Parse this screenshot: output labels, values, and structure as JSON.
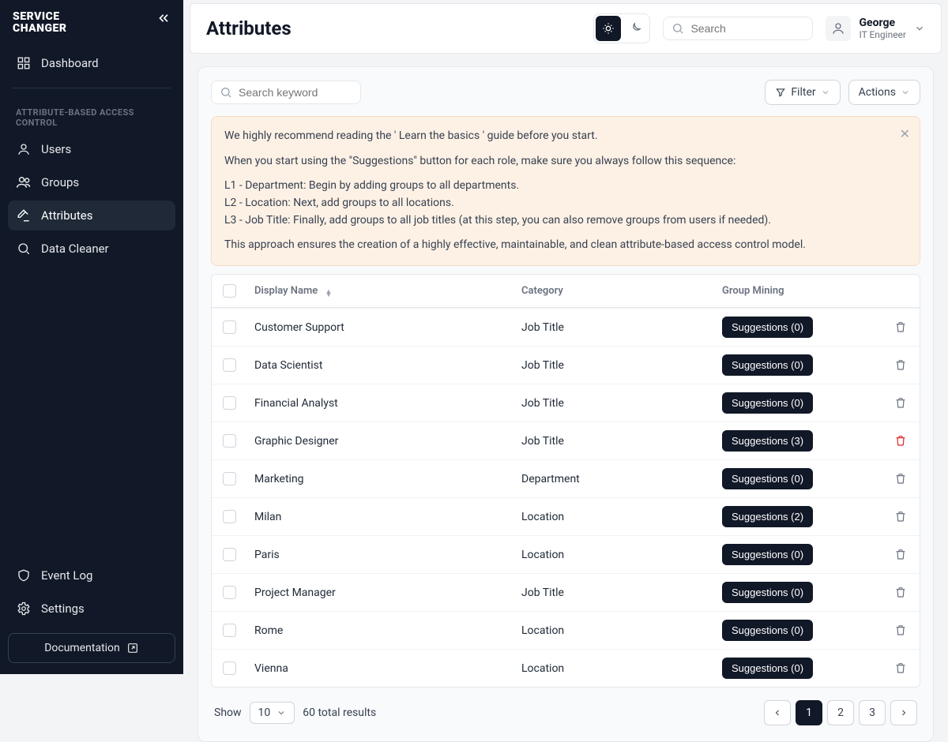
{
  "brand": {
    "line1": "SERVICE",
    "line2": "CHANGER"
  },
  "sidebar": {
    "dashboard": "Dashboard",
    "section": "ATTRIBUTE-BASED ACCESS CONTROL",
    "users": "Users",
    "groups": "Groups",
    "attributes": "Attributes",
    "datacleaner": "Data Cleaner",
    "eventlog": "Event Log",
    "settings": "Settings",
    "documentation": "Documentation"
  },
  "header": {
    "title": "Attributes",
    "search_placeholder": "Search",
    "user": {
      "name": "George",
      "role": "IT Engineer"
    }
  },
  "toolbar": {
    "keyword_placeholder": "Search keyword",
    "filter": "Filter",
    "actions": "Actions"
  },
  "info": {
    "p1": "We highly recommend reading the ' Learn the basics ' guide before you start.",
    "p2": "When you start using the \"Suggestions\" button for each role, make sure you always follow this sequence:",
    "l1": "L1 - Department: Begin by adding groups to all departments.",
    "l2": "L2 - Location: Next, add groups to all locations.",
    "l3": "L3 - Job Title: Finally, add groups to all job titles (at this step, you can also remove groups from users if needed).",
    "p3": "This approach ensures the creation of a highly effective, maintainable, and clean attribute-based access control model."
  },
  "table": {
    "headers": {
      "display_name": "Display Name",
      "category": "Category",
      "group_mining": "Group Mining"
    },
    "rows": [
      {
        "name": "Customer Support",
        "category": "Job Title",
        "suggestions": "Suggestions (0)",
        "danger": false
      },
      {
        "name": "Data Scientist",
        "category": "Job Title",
        "suggestions": "Suggestions (0)",
        "danger": false
      },
      {
        "name": "Financial Analyst",
        "category": "Job Title",
        "suggestions": "Suggestions (0)",
        "danger": false
      },
      {
        "name": "Graphic Designer",
        "category": "Job Title",
        "suggestions": "Suggestions (3)",
        "danger": true
      },
      {
        "name": "Marketing",
        "category": "Department",
        "suggestions": "Suggestions (0)",
        "danger": false
      },
      {
        "name": "Milan",
        "category": "Location",
        "suggestions": "Suggestions (2)",
        "danger": false
      },
      {
        "name": "Paris",
        "category": "Location",
        "suggestions": "Suggestions (0)",
        "danger": false
      },
      {
        "name": "Project Manager",
        "category": "Job Title",
        "suggestions": "Suggestions (0)",
        "danger": false
      },
      {
        "name": "Rome",
        "category": "Location",
        "suggestions": "Suggestions (0)",
        "danger": false
      },
      {
        "name": "Vienna",
        "category": "Location",
        "suggestions": "Suggestions (0)",
        "danger": false
      }
    ]
  },
  "footer": {
    "show": "Show",
    "page_size": "10",
    "total": "60 total results",
    "pages": [
      "1",
      "2",
      "3"
    ],
    "active_page": "1"
  }
}
